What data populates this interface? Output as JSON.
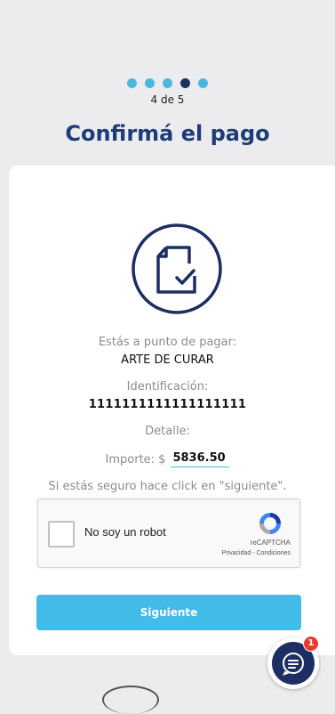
{
  "steps": {
    "total": 5,
    "current": 4,
    "label": "4 de 5"
  },
  "page": {
    "title": "Confirmá el pago"
  },
  "payment": {
    "about_to_pay_label": "Estás a punto de pagar:",
    "merchant": "ARTE DE CURAR",
    "id_label": "Identificación:",
    "id_value": "1111111111111111111",
    "detail_label": "Detalle:",
    "amount_label": "Importe: $",
    "amount_value": "5836.50",
    "confirm_hint": "Si estás seguro hace click en \"siguiente\"."
  },
  "captcha": {
    "label": "No soy un robot",
    "brand": "reCAPTCHA",
    "links": "Privacidad - Condiciones"
  },
  "actions": {
    "next_label": "Siguiente"
  },
  "chat": {
    "badge_count": "1",
    "icon": "chat-icon"
  },
  "colors": {
    "accent": "#43bbe8",
    "primary": "#1d2e64",
    "badge": "#e83a2c"
  }
}
